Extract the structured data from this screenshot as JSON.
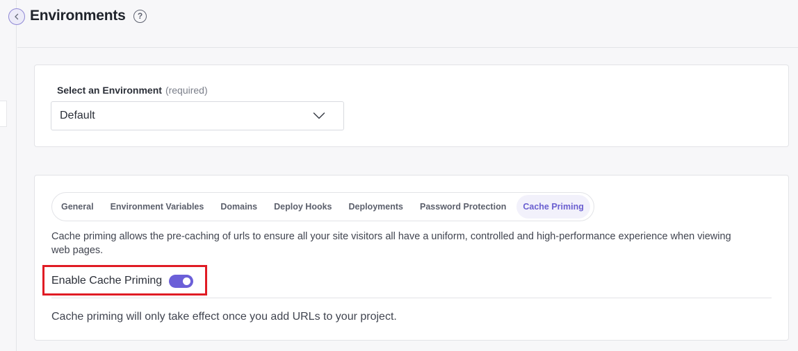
{
  "header": {
    "title": "Environments",
    "help_glyph": "?",
    "back_icon": "chevron-left-icon"
  },
  "environment_select": {
    "label": "Select an Environment",
    "required_text": "(required)",
    "value": "Default",
    "icon": "chevron-down-icon"
  },
  "tabs": [
    {
      "label": "General",
      "active": false
    },
    {
      "label": "Environment Variables",
      "active": false
    },
    {
      "label": "Domains",
      "active": false
    },
    {
      "label": "Deploy Hooks",
      "active": false
    },
    {
      "label": "Deployments",
      "active": false
    },
    {
      "label": "Password Protection",
      "active": false
    },
    {
      "label": "Cache Priming",
      "active": true
    }
  ],
  "cache_priming": {
    "description": "Cache priming allows the pre-caching of urls to ensure all your site visitors all have a uniform, controlled and high-performance experience when viewing web pages.",
    "toggle_label": "Enable Cache Priming",
    "toggle_on": true,
    "note": "Cache priming will only take effect once you add URLs to your project."
  },
  "colors": {
    "accent": "#6b5fd8",
    "highlight": "#e01b24",
    "background": "#f7f7f9"
  }
}
